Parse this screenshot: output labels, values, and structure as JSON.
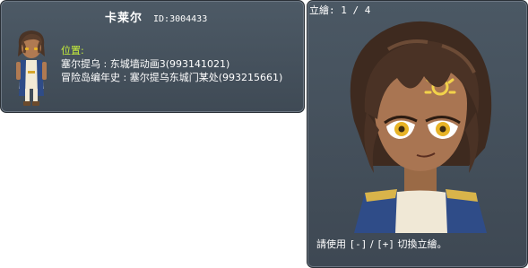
{
  "npc": {
    "name": "卡莱尔",
    "id_text": "ID:3004433"
  },
  "location": {
    "label": "位置:",
    "entries": [
      {
        "text": "塞尔提乌 : 东城墙动画3(993141021)"
      },
      {
        "text": "冒险岛编年史 : 塞尔提乌东城门某处(993215661)"
      }
    ]
  },
  "portrait": {
    "page_indicator": "立繪: 1 / 4",
    "current_page": 1,
    "total_pages": 4,
    "hint": {
      "prefix": "請使用 ",
      "key_prev": "[-]",
      "separator": " / ",
      "key_next": "[+]",
      "suffix": " 切換立繪。"
    }
  },
  "colors": {
    "panel_bg": "#46525e",
    "location_label": "#c8f03a",
    "text": "#ffffff"
  }
}
